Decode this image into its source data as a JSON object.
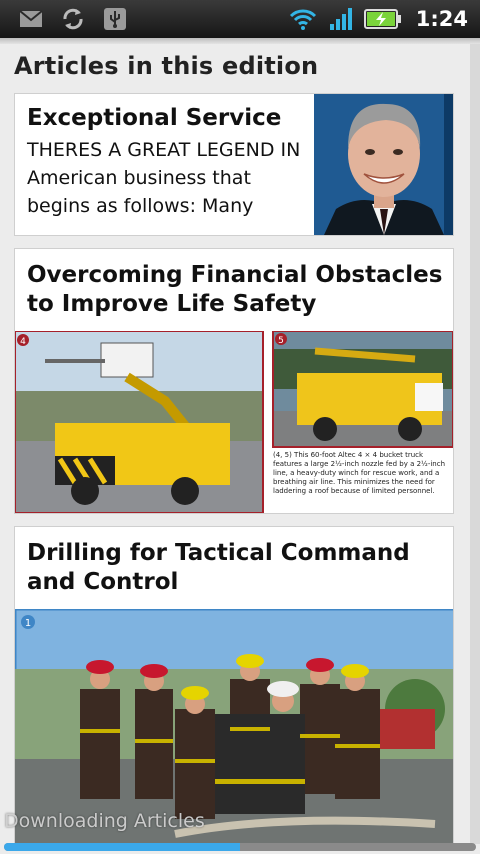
{
  "status_bar": {
    "time": "1:24",
    "icons": [
      "mail-icon",
      "sync-icon",
      "usb-icon",
      "wifi-icon",
      "signal-icon",
      "battery-charging-icon"
    ]
  },
  "page": {
    "heading": "Articles in this edition"
  },
  "articles": [
    {
      "title": "Exceptional Service",
      "excerpt": "THERES A GREAT LEGEND IN American business that begins as follows: Many",
      "image": "portrait of smiling man in suit and tie"
    },
    {
      "title": "Overcoming Financial Obstacles to Improve Life Safety",
      "image": "two photos of yellow bucket trucks",
      "photo_numbers": [
        "4",
        "5"
      ],
      "photo_caption": "(4, 5) This 60-foot Altec 4 × 4 bucket truck features a large 2½-inch nozzle fed by a 2½-inch line, a heavy-duty winch for rescue work, and a breathing air line. This minimizes the need for laddering a roof because of limited personnel."
    },
    {
      "title": "Drilling for Tactical Command and Control",
      "image": "group of firefighters in turnout gear with hose",
      "photo_number": "1"
    }
  ],
  "footer": {
    "status_text": "Downloading Articles",
    "progress": 0.5
  },
  "colors": {
    "accent": "#3ba8ea",
    "status_bar_bg": "#1e1e1e",
    "battery_green": "#7ad33a",
    "signal_blue": "#33b5e5"
  }
}
